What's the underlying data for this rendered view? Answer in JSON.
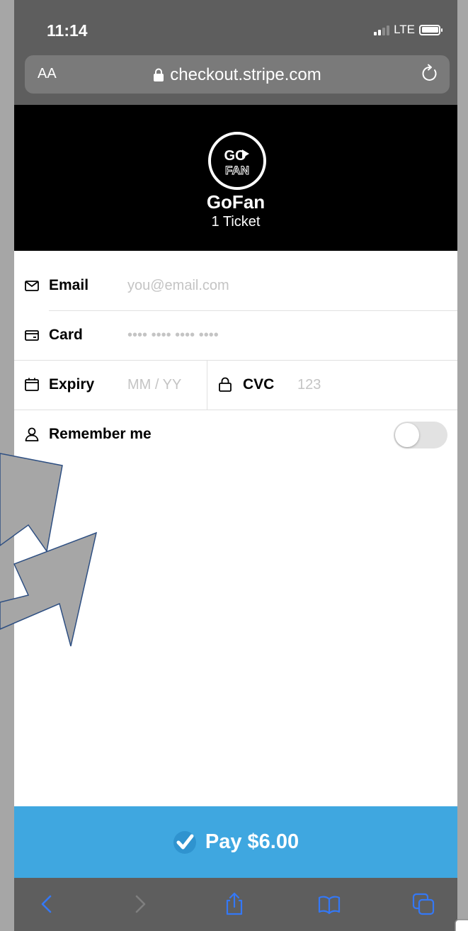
{
  "status_bar": {
    "time": "11:14",
    "network": "LTE"
  },
  "browser": {
    "text_size_label": "AA",
    "url": "checkout.stripe.com"
  },
  "merchant": {
    "name": "GoFan",
    "description": "1 Ticket",
    "logo_text_top": "GO",
    "logo_text_bottom": "FAN"
  },
  "form": {
    "email": {
      "label": "Email",
      "placeholder": "you@email.com"
    },
    "card": {
      "label": "Card",
      "placeholder": "•••• •••• •••• ••••"
    },
    "expiry": {
      "label": "Expiry",
      "placeholder": "MM / YY"
    },
    "cvc": {
      "label": "CVC",
      "placeholder": "123"
    },
    "remember": {
      "label": "Remember me",
      "enabled": false
    }
  },
  "pay_button": {
    "label": "Pay $6.00"
  },
  "colors": {
    "pay_button": "#3fa7e0",
    "header_bg": "#000000",
    "chrome": "#5e5e5e",
    "ios_blue": "#3478f6",
    "annotation_arrow": "#a6a6a6",
    "annotation_outline": "#2e4f82"
  }
}
